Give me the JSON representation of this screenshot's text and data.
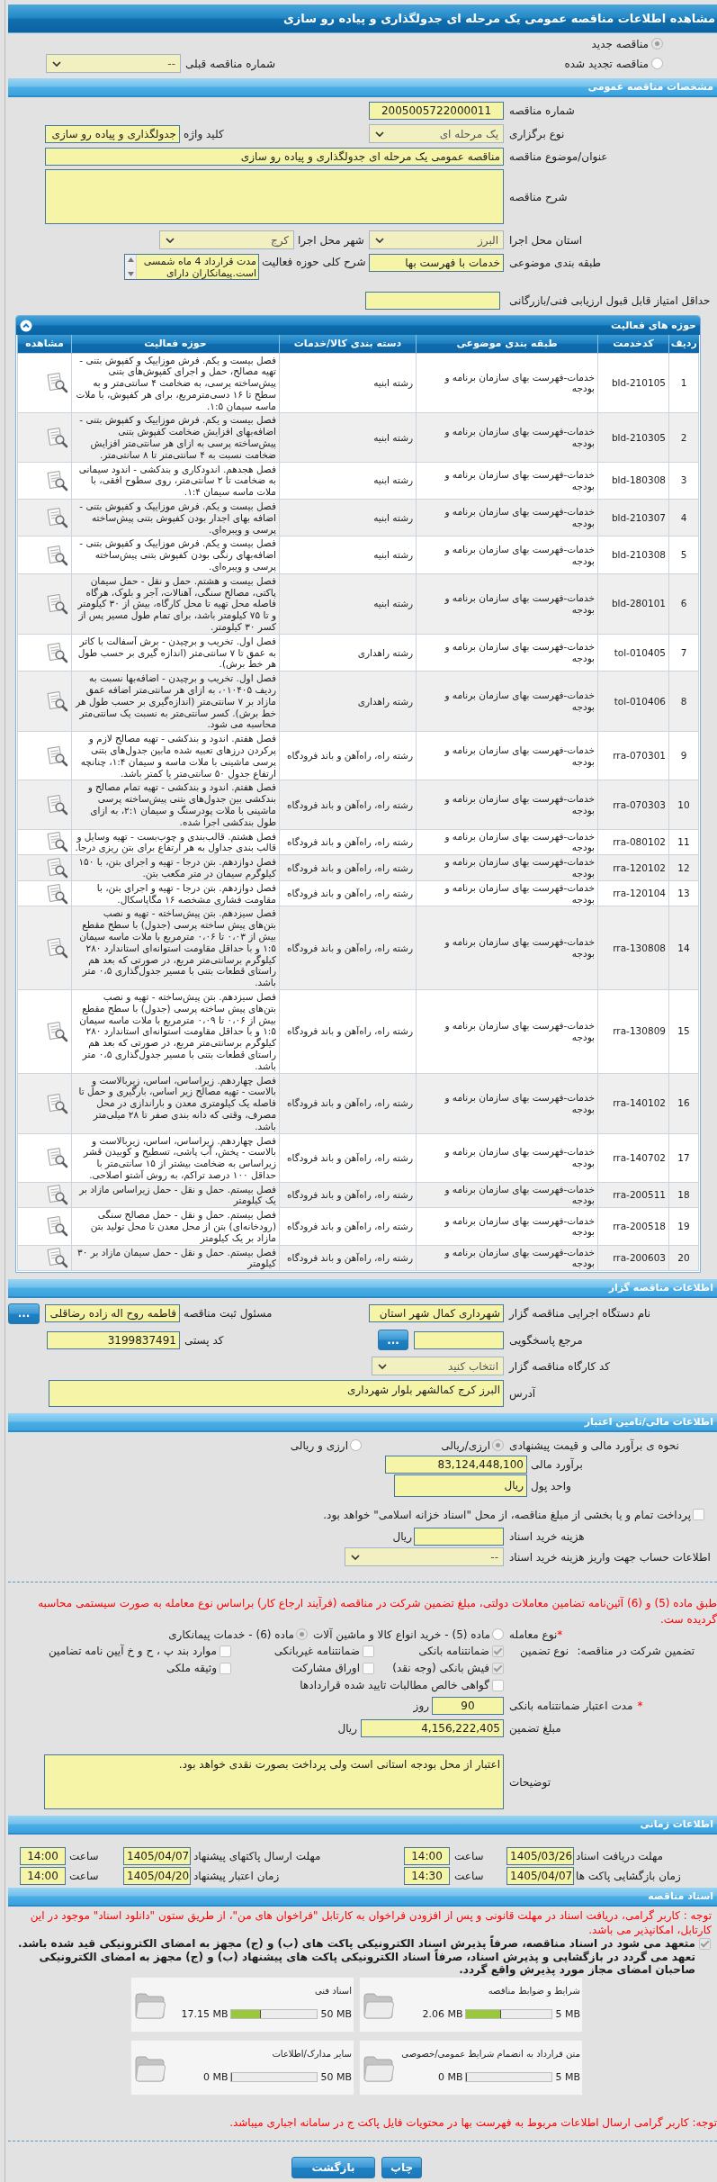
{
  "header": {
    "title": "مشاهده اطلاعات مناقصه عمومی یک مرحله ای جدولگذاری و پیاده رو سازی"
  },
  "tender_type": {
    "options": [
      {
        "label": "مناقصه جدید",
        "selected": true
      },
      {
        "label": "مناقصه تجدید شده",
        "selected": false
      }
    ],
    "previous_number": {
      "label": "شماره مناقصه قبلی",
      "value": "--"
    }
  },
  "general": {
    "title": "مشخصات مناقصه عمومی",
    "tender_number": {
      "label": "شماره مناقصه",
      "value": "2005005722000011"
    },
    "holding_type": {
      "label": "نوع برگزاری",
      "value": "یک مرحله ای"
    },
    "keyword": {
      "label": "کلید واژه",
      "value": "جدولگذاری و پیاده رو سازی"
    },
    "subject": {
      "label": "عنوان/موضوع مناقصه",
      "value": "مناقصه عمومی یک مرحله ای جدولگذاری و پیاده رو سازی"
    },
    "description": {
      "label": "شرح مناقصه"
    },
    "province": {
      "label": "استان محل اجرا",
      "value": "البرز"
    },
    "city": {
      "label": "شهر محل اجرا",
      "value": "کرج"
    },
    "classification": {
      "label": "طبقه بندی موضوعی",
      "value": "خدمات با فهرست بها"
    },
    "activity_scope": {
      "label": "شرح کلی حوزه فعالیت",
      "value": "مدت قرارداد 4 ماه شمسی است.پیمانکاران دارای"
    },
    "min_score": {
      "label": "حداقل امتیاز قابل قبول ارزیابی فنی/بازرگانی"
    }
  },
  "activities": {
    "title": "حوزه های فعالیت",
    "columns": [
      "ردیف",
      "کدخدمت",
      "طبقه بندی موضوعی",
      "دسته بندی کالا/خدمات",
      "حوزه فعالیت",
      "مشاهده"
    ],
    "rows": [
      {
        "index": "1",
        "code": "bld-210105",
        "classification": "خدمات-فهرست بهای سازمان برنامه و بودجه",
        "category": "رشته ابنیه",
        "activity": "فصل بیست و یکم. فرش موزاییک و کفپوش بتنی - تهیه مصالح، حمل و اجرای کفپوش‌های بتنی پیش‌ساخته پرسی، به ضخامت ۴ سانتی‌متر و به سطح تا ۱۶ دسی‌مترمربع، برای هر کفپوش، با ملات ماسه سیمان ۱:۵."
      },
      {
        "index": "2",
        "code": "bld-210305",
        "classification": "خدمات-فهرست بهای سازمان برنامه و بودجه",
        "category": "رشته ابنیه",
        "activity": "فصل بیست و یکم. فرش موزاییک و کفپوش بتنی - اضافه‌بهای افزایش ضخامت کفپوش بتنی پیش‌ساخته پرسی به ازای هر سانتی‌متر افزایش ضخامت نسبت به ۴ سانتی‌متر تا ۸ سانتی‌متر."
      },
      {
        "index": "3",
        "code": "bld-180308",
        "classification": "خدمات-فهرست بهای سازمان برنامه و بودجه",
        "category": "رشته ابنیه",
        "activity": "فصل هجدهم. اندودکاری و بندکشی - اندود سیمانی به ضخامت تا ۲ سانتی‌متر، روی سطوح افقی، با ملات ماسه سیمان ۱:۴."
      },
      {
        "index": "4",
        "code": "bld-210307",
        "classification": "خدمات-فهرست بهای سازمان برنامه و بودجه",
        "category": "رشته ابنیه",
        "activity": "فصل بیست و یکم. فرش موزاییک و کفپوش بتنی - اضافه بهای اجدار بودن کفپوش بتنی پیش‌ساخته پرسی و ویبره‌ای."
      },
      {
        "index": "5",
        "code": "bld-210308",
        "classification": "خدمات-فهرست بهای سازمان برنامه و بودجه",
        "category": "رشته ابنیه",
        "activity": "فصل بیست و یکم. فرش موزاییک و کفپوش بتنی - اضافه‌بهای رنگی بودن کفپوش بتنی پیش‌ساخته پرسی و ویبره‌ای."
      },
      {
        "index": "6",
        "code": "bld-280101",
        "classification": "خدمات-فهرست بهای سازمان برنامه و بودجه",
        "category": "رشته ابنیه",
        "activity": "فصل بیست و هشتم. حمل و نقل - حمل سیمان پاکتی، مصالح سنگی، آهنالات، آجر و بلوک، هرگاه فاصله محل تهیه تا محل کارگاه، بیش از ۳۰ کیلومتر و تا ۷۵ کیلومتر باشد، برای تمام طول مسیر پس از کسر ۳۰ کیلومتر."
      },
      {
        "index": "7",
        "code": "tol-010405",
        "classification": "خدمات-فهرست بهای سازمان برنامه و بودجه",
        "category": "رشته راهداری",
        "activity": "فصل اول. تخریب و برچیدن - برش آسفالت با کاتر به عمق تا ۷ سانتی‌متر (اندازه گیری بر حسب طول هر خط برش)."
      },
      {
        "index": "8",
        "code": "tol-010406",
        "classification": "خدمات-فهرست بهای سازمان برنامه و بودجه",
        "category": "رشته راهداری",
        "activity": "فصل اول. تخریب و برچیدن - اضافه‌بها نسبت به ردیف ۰۱۰۴۰۵، به ازای هر سانتی‌متر اضافه عمق مازاد بر ۷ سانتی‌متر (اندازه‌گیری بر حسب طول هر خط برش). کسر سانتی‌متر به نسبت یک سانتی‌متر محاسبه می شود."
      },
      {
        "index": "9",
        "code": "rra-070301",
        "classification": "خدمات-فهرست بهای سازمان برنامه و بودجه",
        "category": "رشته راه، راه‌آهن و باند فرودگاه",
        "activity": "فصل هفتم. اندود و بندکشی - تهیه مصالح لازم و پرکردن درزهای تعبیه شده مابین جدول‌های بتنی پرسی ماشینی با ملات ماسه و سیمان ۱:۴، چنانچه ارتفاع جدول ۵۰ سانتی‌متر یا کمتر باشد."
      },
      {
        "index": "10",
        "code": "rra-070303",
        "classification": "خدمات-فهرست بهای سازمان برنامه و بودجه",
        "category": "رشته راه، راه‌آهن و باند فرودگاه",
        "activity": "فصل هفتم. اندود و بندکشی - تهیه تمام مصالح و بندکشی بین جدول‌های بتنی پیش‌ساخته پرسی ماشینی با ملات پودرسنگ و سیمان ۲:۱، به ازای طول بندکشی اجرا شده."
      },
      {
        "index": "11",
        "code": "rra-080102",
        "classification": "خدمات-فهرست بهای سازمان برنامه و بودجه",
        "category": "رشته راه، راه‌آهن و باند فرودگاه",
        "activity": "فصل هشتم. قالب‌بندی و چوب‌بست - تهیه وسایل و قالب بندی جداول به هر ارتفاع برای بتن ریزی درجا."
      },
      {
        "index": "12",
        "code": "rra-120102",
        "classification": "خدمات-فهرست بهای سازمان برنامه و بودجه",
        "category": "رشته راه، راه‌آهن و باند فرودگاه",
        "activity": "فصل دوازدهم. بتن درجا - تهیه و اجرای بتن، با ۱۵۰ کیلوگرم سیمان در متر مکعب بتن."
      },
      {
        "index": "13",
        "code": "rra-120104",
        "classification": "خدمات-فهرست بهای سازمان برنامه و بودجه",
        "category": "رشته راه، راه‌آهن و باند فرودگاه",
        "activity": "فصل دوازدهم. بتن درجا - تهیه و اجرای بتن، با مقاومت فشاری مشخصه ۱۶ مگاپاسکال."
      },
      {
        "index": "14",
        "code": "rra-130808",
        "classification": "خدمات-فهرست بهای سازمان برنامه و بودجه",
        "category": "رشته راه، راه‌آهن و باند فرودگاه",
        "activity": "فصل سیزدهم. بتن پیش‌ساخته - تهیه و نصب بتن‌های پیش ساخته پرسی (جدول) با سطح مقطع بیش از ۰،۰۳ تا ۰،۰۶ مترمربع با ملات ماسه سیمان ۱:۵ و با حداقل مقاومت استوانه‌ای استاندارد ۲۸۰ کیلوگرم برسانتی‌متر مربع، در صورتی که بعد هم راستای قطعات بتنی با مسیر جدول‌گذاری ۰،۵ متر باشد."
      },
      {
        "index": "15",
        "code": "rra-130809",
        "classification": "خدمات-فهرست بهای سازمان برنامه و بودجه",
        "category": "رشته راه، راه‌آهن و باند فرودگاه",
        "activity": "فصل سیزدهم. بتن پیش‌ساخته - تهیه و نصب بتن‌های پیش ساخته پرسی (جدول) با سطح مقطع بیش از ۰،۰۶ تا ۰،۰۹ مترمربع با ملات ماسه سیمان ۱:۵ و با حداقل مقاومت استوانه‌ای استاندارد ۲۸۰ کیلوگرم برسانتی‌متر مربع، در صورتی که بعد هم راستای قطعات بتنی با مسیر جدول‌گذاری ۰،۵ متر باشد."
      },
      {
        "index": "16",
        "code": "rra-140102",
        "classification": "خدمات-فهرست بهای سازمان برنامه و بودجه",
        "category": "رشته راه، راه‌آهن و باند فرودگاه",
        "activity": "فصل چهاردهم. زیراساس، اساس، زیربالاست و بالاست - تهیه مصالح زیر اساس، بارگیری و حمل تا فاصله یک کیلومتری معدن و باراندازی در محل مصرف، وقتی که دانه بندی صفر تا ۲۸ میلی‌متر باشد."
      },
      {
        "index": "17",
        "code": "rra-140702",
        "classification": "خدمات-فهرست بهای سازمان برنامه و بودجه",
        "category": "رشته راه، راه‌آهن و باند فرودگاه",
        "activity": "فصل چهاردهم. زیراساس، اساس، زیربالاست و بالاست - پخش، آب پاشی، تسطیح و کوبیدن قشر زیراساس به ضخامت بیشتر از ۱۵ سانتی‌متر با حداقل ۱۰۰ درصد تراکم، به روش آشتو اصلاحی."
      },
      {
        "index": "18",
        "code": "rra-200511",
        "classification": "خدمات-فهرست بهای سازمان برنامه و بودجه",
        "category": "رشته راه، راه‌آهن و باند فرودگاه",
        "activity": "فصل بیستم. حمل و نقل - حمل زیراساس مازاد بر یک کیلومتر"
      },
      {
        "index": "19",
        "code": "rra-200518",
        "classification": "خدمات-فهرست بهای سازمان برنامه و بودجه",
        "category": "رشته راه، راه‌آهن و باند فرودگاه",
        "activity": "فصل بیستم. حمل و نقل - حمل مصالح سنگی (رودخانه‌ای) بتن از محل معدن تا محل تولید بتن مازاد بر یک کیلومتر"
      },
      {
        "index": "20",
        "code": "rra-200603",
        "classification": "خدمات-فهرست بهای سازمان برنامه و بودجه",
        "category": "رشته راه، راه‌آهن و باند فرودگاه",
        "activity": "فصل بیستم. حمل و نقل - حمل سیمان مازاد بر ۳۰ کیلومتر"
      }
    ]
  },
  "employer": {
    "title": "اطلاعات مناقصه گزار",
    "agency": {
      "label": "نام دستگاه اجرایی مناقصه گزار",
      "value": "شهرداری کمال شهر استان"
    },
    "registrar": {
      "label": "مسئول ثبت مناقصه",
      "value": "فاطمه روح اله زاده رضاقلی",
      "button": "..."
    },
    "reference": {
      "label": "مرجع پاسخگویی",
      "button": "..."
    },
    "postal_code": {
      "label": "کد پستی",
      "value": "3199837491"
    },
    "workshop_code": {
      "label": "کد کارگاه مناقصه گزار",
      "value": "انتخاب کنید"
    },
    "address": {
      "label": "آدرس",
      "value": "البرز کرج کمالشهر بلوار شهرداری"
    }
  },
  "finance": {
    "title": "اطلاعات مالی/تامین اعتبار",
    "estimate_method": {
      "label": "نحوه ی برآورد مالی و قیمت پیشنهادی",
      "options": [
        {
          "label": "ارزی/ریالی",
          "selected": true
        },
        {
          "label": "ارزی و ریالی",
          "selected": false
        }
      ]
    },
    "estimate": {
      "label": "برآورد مالی",
      "value": "83,124,448,100"
    },
    "currency": {
      "label": "واحد پول",
      "value": "ریال"
    },
    "treasury": {
      "label": "پرداخت تمام و یا بخشی از مبلغ مناقصه، از محل \"اسناد خزانه اسلامی\" خواهد بود.",
      "checked": false
    },
    "doc_fee": {
      "label": "هزینه خرید اسناد",
      "unit": "ریال"
    },
    "account": {
      "label": "اطلاعات حساب جهت واریز هزینه خرید اسناد",
      "value": "--"
    }
  },
  "guarantee": {
    "note": "طبق ماده (5) و (6) آئین‌نامه تضامین معاملات دولتی، مبلغ تضمین شرکت در مناقصه (فرآیند ارجاع کار) براساس نوع معامله به صورت سیستمی محاسبه گردیده ست.",
    "deal_type": {
      "marker": "*",
      "label": "نوع معامله",
      "options": [
        {
          "label": "ماده (5) - خرید انواع کالا و ماشین آلات",
          "selected": false
        },
        {
          "label": "ماده (6) - خدمات پیمانکاری",
          "selected": true
        }
      ]
    },
    "heading": "تضمین شرکت در مناقصه:",
    "type_label": "نوع تضمین",
    "types": [
      {
        "label": "ضمانتنامه بانکی",
        "checked": true
      },
      {
        "label": "ضمانتنامه غیربانکی",
        "checked": false
      },
      {
        "label": "موارد بند پ ، ح و خ آیین نامه تضامین",
        "checked": false
      },
      {
        "label": "فیش بانکی (وجه نقد)",
        "checked": true
      },
      {
        "label": "اوراق مشارکت",
        "checked": false
      },
      {
        "label": "وثیقه ملکی",
        "checked": false
      },
      {
        "label": "گواهی خالص مطالبات تایید شده قراردادها",
        "checked": false
      }
    ],
    "validity": {
      "marker": "*",
      "label": "مدت اعتبار ضمانتنامه بانکی",
      "value": "90",
      "unit": "روز"
    },
    "amount": {
      "label": "مبلغ تضمین",
      "value": "4,156,222,405",
      "unit": "ریال"
    },
    "notes": {
      "label": "توضیحات",
      "value": "اعتبار از محل بودجه استانی است ولی پرداخت بصورت نقدی خواهد بود."
    }
  },
  "schedule": {
    "title": "اطلاعات زمانی",
    "items": [
      {
        "label": "مهلت دریافت اسناد",
        "date": "1405/03/26",
        "time_label": "ساعت",
        "time": "14:00"
      },
      {
        "label": "مهلت ارسال پاکتهای پیشنهاد",
        "date": "1405/04/07",
        "time_label": "ساعت",
        "time": "14:00"
      },
      {
        "label": "زمان بازگشایی پاکت ها",
        "date": "1405/04/07",
        "time_label": "ساعت",
        "time": "14:30"
      },
      {
        "label": "زمان اعتبار پیشنهاد",
        "date": "1405/04/20",
        "time_label": "ساعت",
        "time": "14:00"
      }
    ]
  },
  "documents": {
    "title": "اسناد مناقصه",
    "note": "توجه : کاربر گرامی، دریافت اسناد در مهلت قانونی و پس از افزودن فراخوان به کارتابل \"فراخوان های من\"، از طریق ستون \"دانلود اسناد\" موجود در این کارتابل، امکانپذیر می باشد.",
    "commitment": {
      "text": "متعهد می شود در اسناد مناقصه، صرفاً پذیرش اسناد الکترونیکی پاکت های (ب) و (ج) مجهز به امضای الکترونیکی قید شده باشد. تعهد می گردد در بازگشایی و پذیرش اسناد، صرفاً اسناد الکترونیکی پاکت های پیشنهاد (ب) و (ج) مجهز به امضای الکترونیکی صاحبان امضای مجاز مورد پذیرش واقع گردد.",
      "checked": true
    },
    "files": [
      {
        "title": "شرایط و ضوابط مناقصه",
        "max": "5 MB",
        "size": "2.06 MB",
        "level": 0.41
      },
      {
        "title": "اسناد فنی",
        "max": "50 MB",
        "size": "17.15 MB",
        "level": 0.343
      },
      {
        "title": "متن قرارداد به انضمام شرایط عمومی/خصوصی",
        "max": "5 MB",
        "size": "0 MB",
        "level": 0
      },
      {
        "title": "سایر مدارک/اطلاعات",
        "max": "50 MB",
        "size": "0 MB",
        "level": 0
      }
    ],
    "footer_note": "توجه: کاربر گرامی ارسال اطلاعات مربوط به فهرست بها در محتویات فایل پاکت ج در سامانه اجباری میباشد."
  },
  "buttons": [
    {
      "label": "چاپ"
    },
    {
      "label": "بازگشت"
    }
  ]
}
